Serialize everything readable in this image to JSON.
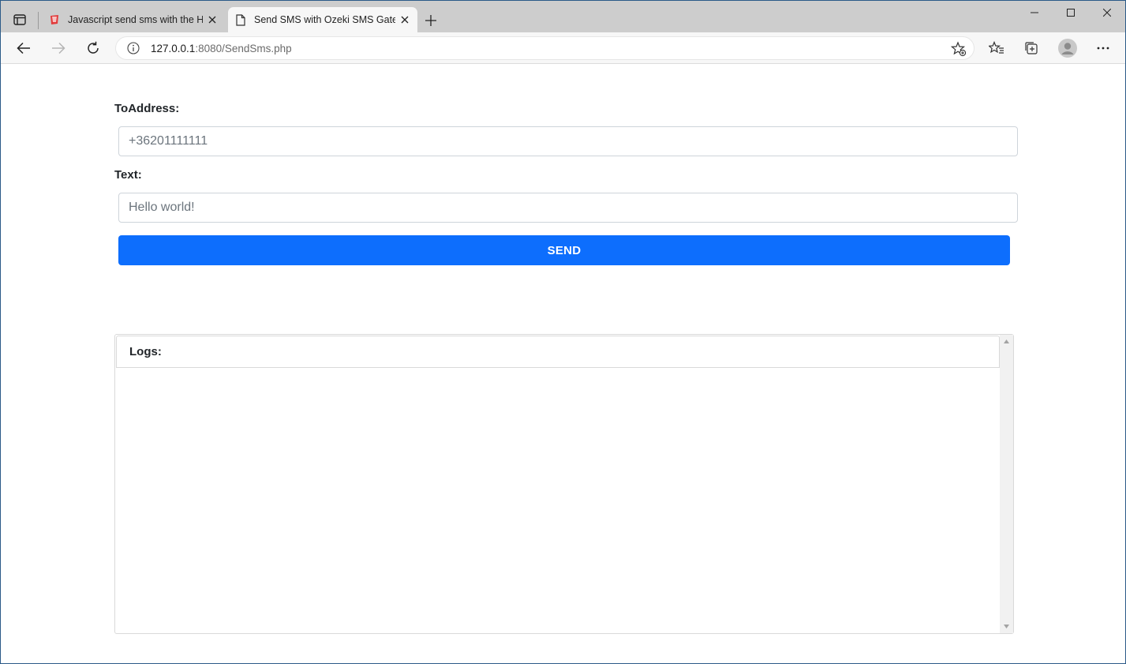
{
  "browser": {
    "tabs": [
      {
        "title": "Javascript send sms with the HTTP",
        "favicon": "ozeki-favicon",
        "active": false
      },
      {
        "title": "Send SMS with Ozeki SMS Gateway",
        "favicon": "page-icon",
        "active": true
      }
    ],
    "address": {
      "host": "127.0.0.1",
      "rest": ":8080/SendSms.php"
    }
  },
  "form": {
    "to_label": "ToAddress:",
    "to_value": "+36201111111",
    "text_label": "Text:",
    "text_value": "Hello world!",
    "send_label": "SEND"
  },
  "logs": {
    "header": "Logs:"
  },
  "colors": {
    "accent": "#0d6efd",
    "tabstrip": "#cdcdcd",
    "toolbar": "#f7f7f7"
  }
}
